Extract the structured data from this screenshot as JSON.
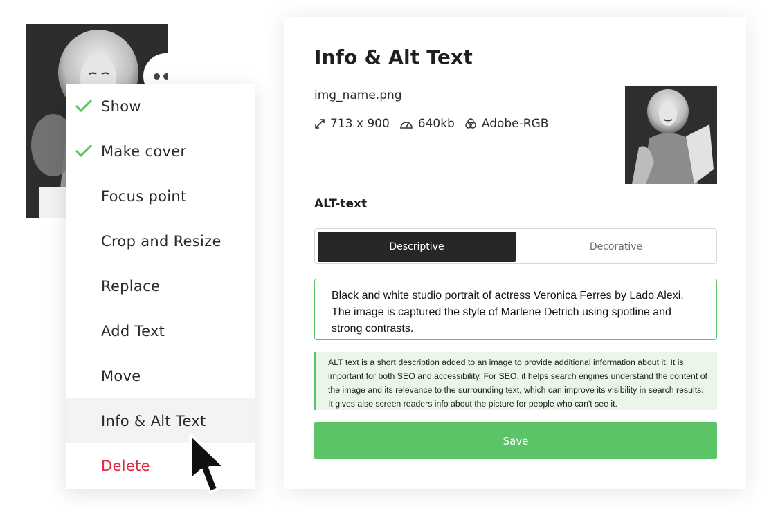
{
  "thumbnail": {
    "more_icon": "more-horizontal-icon"
  },
  "menu": {
    "items": [
      {
        "label": "Show",
        "checked": true
      },
      {
        "label": "Make cover",
        "checked": true
      },
      {
        "label": "Focus point",
        "checked": false
      },
      {
        "label": "Crop and Resize",
        "checked": false
      },
      {
        "label": "Replace",
        "checked": false
      },
      {
        "label": "Add Text",
        "checked": false
      },
      {
        "label": "Move",
        "checked": false
      },
      {
        "label": "Info & Alt Text",
        "checked": false,
        "active": true
      },
      {
        "label": "Delete",
        "checked": false,
        "danger": true
      }
    ],
    "check_color": "#5bc467",
    "danger_color": "#e0283f"
  },
  "panel": {
    "title": "Info & Alt Text",
    "file_name": "img_name.png",
    "dimensions": "713 x 900",
    "size": "640kb",
    "color_profile": "Adobe-RGB",
    "alt_label": "ALT-text",
    "tabs": [
      {
        "label": "Descriptive",
        "selected": true
      },
      {
        "label": "Decorative",
        "selected": false
      }
    ],
    "alt_text": "Black and white studio portrait of actress Veronica Ferres by Lado Alexi. The image is captured the style of Marlene Detrich using spotline and strong contrasts.",
    "help_text": "ALT text is a short description added to an image to provide additional information about it. It is important for both SEO and accessibility. For SEO, it helps search engines understand the content of the image and its relevance to the surrounding text, which can improve its visibility in search results. It gives also screen readers info about the picture for people who can't see it.",
    "save_label": "Save",
    "accent_color": "#5bc467"
  }
}
